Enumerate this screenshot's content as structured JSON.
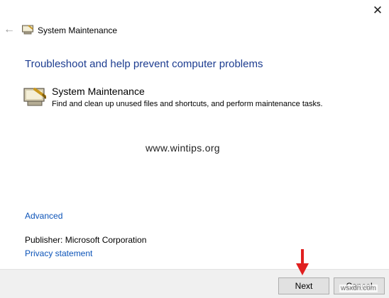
{
  "window": {
    "title": "System Maintenance",
    "close_glyph": "✕",
    "back_glyph": "←"
  },
  "main": {
    "heading": "Troubleshoot and help prevent computer problems",
    "task": {
      "title": "System Maintenance",
      "description": "Find and clean up unused files and shortcuts, and perform maintenance tasks.",
      "icon": "system-maintenance-icon"
    },
    "watermark": "www.wintips.org",
    "advanced_link": "Advanced",
    "publisher": "Publisher:  Microsoft Corporation",
    "privacy_link": "Privacy statement"
  },
  "footer": {
    "next_label": "Next",
    "cancel_label": "Cancel",
    "site_mark": "wsxdn.com"
  },
  "colors": {
    "heading": "#1c3c90",
    "link": "#0b53b8",
    "arrow": "#e02020",
    "footer_bg": "#f0f0f0"
  }
}
